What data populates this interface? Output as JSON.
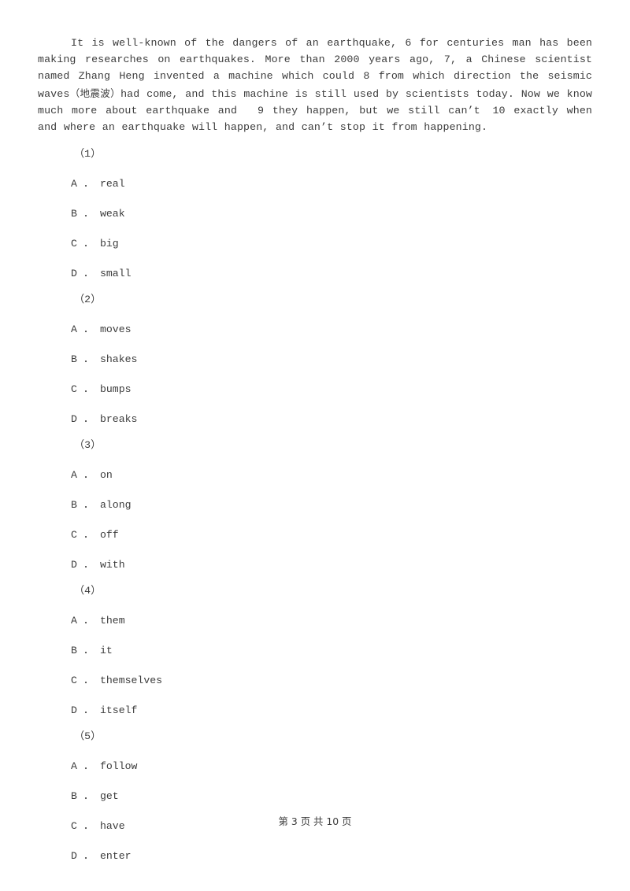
{
  "document": {
    "type": "exam-worksheet",
    "language": "en-zh",
    "text_color": "#3c3c3c",
    "background_color": "#ffffff"
  },
  "passage": {
    "segment_1": "It is well-known of the dangers of an earthquake, 6 for centuries man has been making researches on earthquakes. More than 2000 years ago, 7, a Chinese scientist named Zhang Heng invented a machine which could 8 from which direction the seismic waves",
    "chinese_gloss": "（地震波）",
    "segment_2": "had come, and this machine is still used by scientists today. Now we know much more about earthquake and",
    "blank_9": "9",
    "segment_3": "they happen, but we still can’t",
    "blank_10": "10",
    "segment_4": "exactly when and where an earthquake will happen, and can’t stop it from happening."
  },
  "questions": [
    {
      "number": "（1）",
      "options": [
        {
          "letter": "A",
          "separator": "．",
          "text": "real"
        },
        {
          "letter": "B",
          "separator": "．",
          "text": "weak"
        },
        {
          "letter": "C",
          "separator": "．",
          "text": "big"
        },
        {
          "letter": "D",
          "separator": "．",
          "text": "small"
        }
      ]
    },
    {
      "number": "（2）",
      "options": [
        {
          "letter": "A",
          "separator": "．",
          "text": "moves"
        },
        {
          "letter": "B",
          "separator": "．",
          "text": "shakes"
        },
        {
          "letter": "C",
          "separator": "．",
          "text": "bumps"
        },
        {
          "letter": "D",
          "separator": "．",
          "text": "breaks"
        }
      ]
    },
    {
      "number": "（3）",
      "options": [
        {
          "letter": "A",
          "separator": "．",
          "text": "on"
        },
        {
          "letter": "B",
          "separator": "．",
          "text": "along"
        },
        {
          "letter": "C",
          "separator": "．",
          "text": "off"
        },
        {
          "letter": "D",
          "separator": "．",
          "text": "with"
        }
      ]
    },
    {
      "number": "（4）",
      "options": [
        {
          "letter": "A",
          "separator": "．",
          "text": "them"
        },
        {
          "letter": "B",
          "separator": "．",
          "text": "it"
        },
        {
          "letter": "C",
          "separator": "．",
          "text": "themselves"
        },
        {
          "letter": "D",
          "separator": "．",
          "text": "itself"
        }
      ]
    },
    {
      "number": "（5）",
      "options": [
        {
          "letter": "A",
          "separator": "．",
          "text": "follow"
        },
        {
          "letter": "B",
          "separator": "．",
          "text": "get"
        },
        {
          "letter": "C",
          "separator": "．",
          "text": "have"
        },
        {
          "letter": "D",
          "separator": "．",
          "text": "enter"
        }
      ]
    }
  ],
  "footer": {
    "text": "第 3 页 共 10 页",
    "current_page": "3",
    "total_pages": "10"
  }
}
